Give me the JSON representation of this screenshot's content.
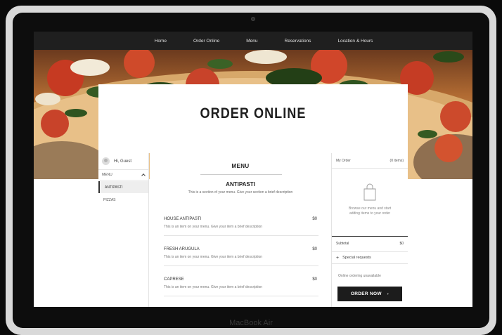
{
  "device": {
    "model_label": "MacBook Air"
  },
  "nav": {
    "items": [
      "Home",
      "Order Online",
      "Menu",
      "Reservations",
      "Location & Hours"
    ]
  },
  "hero": {
    "title": "ORDER ONLINE"
  },
  "sidebar": {
    "greeting": "Hi, Guest",
    "menu_label": "MENU",
    "sections": [
      "ANTIPASTI",
      "PIZZAS"
    ],
    "active_section": "ANTIPASTI"
  },
  "main": {
    "menu_title": "MENU",
    "section_title": "ANTIPASTI",
    "section_desc": "This is a section of your menu. Give your section a brief description",
    "items": [
      {
        "name": "HOUSE ANTIPASTI",
        "price": "$0",
        "desc": "This is an item on your menu. Give your item a brief description"
      },
      {
        "name": "FRESH ARUGULA",
        "price": "$0",
        "desc": "This is an item on your menu. Give your item a brief description"
      },
      {
        "name": "CAPRESE",
        "price": "$0",
        "desc": "This is an item on your menu. Give your item a brief description"
      }
    ]
  },
  "order": {
    "title": "My Order",
    "count": "(0 items)",
    "empty_text": "Browse our menu and start adding items to your order",
    "subtotal_label": "Subtotal",
    "subtotal_value": "$0",
    "special_requests": "Special requests",
    "unavailable": "Online ordering unavailable",
    "button_label": "ORDER NOW",
    "button_arrow": "›"
  },
  "colors": {
    "nav_bg": "#1f1f1f",
    "button_bg": "#1c1c1c",
    "active_bg": "#eeeeee"
  }
}
